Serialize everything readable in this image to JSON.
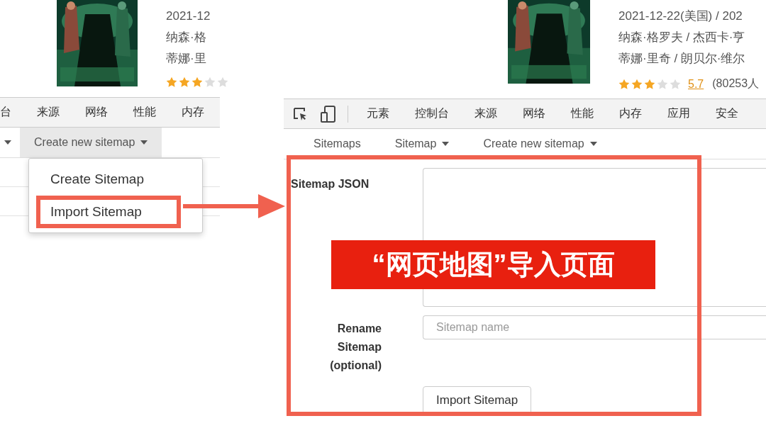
{
  "left_screen": {
    "movie": {
      "info_lines": [
        "2021-12",
        "纳森·格",
        "蒂娜·里"
      ],
      "stars": 3
    },
    "devtools_tabs": [
      "台",
      "来源",
      "网络",
      "性能",
      "内存"
    ],
    "nav": [
      {
        "kind": "caret",
        "open": false
      },
      {
        "kind": "dropdown",
        "label": "Create new sitemap",
        "open": true
      }
    ],
    "menu": [
      {
        "label": "Create Sitemap",
        "annotated": false
      },
      {
        "label": "Import Sitemap",
        "annotated": true
      }
    ]
  },
  "right_screen": {
    "movie": {
      "info_lines": [
        "2021-12-22(美国) / 202",
        "纳森·格罗夫 / 杰西卡·亨",
        "蒂娜·里奇 / 朗贝尔·维尔"
      ],
      "stars": 3,
      "score": "5.7",
      "votes": "(80253人"
    },
    "devtools_tabs": [
      "元素",
      "控制台",
      "来源",
      "网络",
      "性能",
      "内存",
      "应用",
      "安全"
    ],
    "nav": [
      {
        "kind": "link",
        "label": "Sitemaps",
        "open": false
      },
      {
        "kind": "dropdown",
        "label": "Sitemap",
        "open": false
      },
      {
        "kind": "dropdown",
        "label": "Create new sitemap",
        "open": false
      }
    ],
    "form": {
      "json_label": "Sitemap JSON",
      "rename_label": "Rename Sitemap (optional)",
      "name_placeholder": "Sitemap name",
      "submit": "Import Sitemap"
    },
    "caption": "“网页地图”导入页面"
  }
}
